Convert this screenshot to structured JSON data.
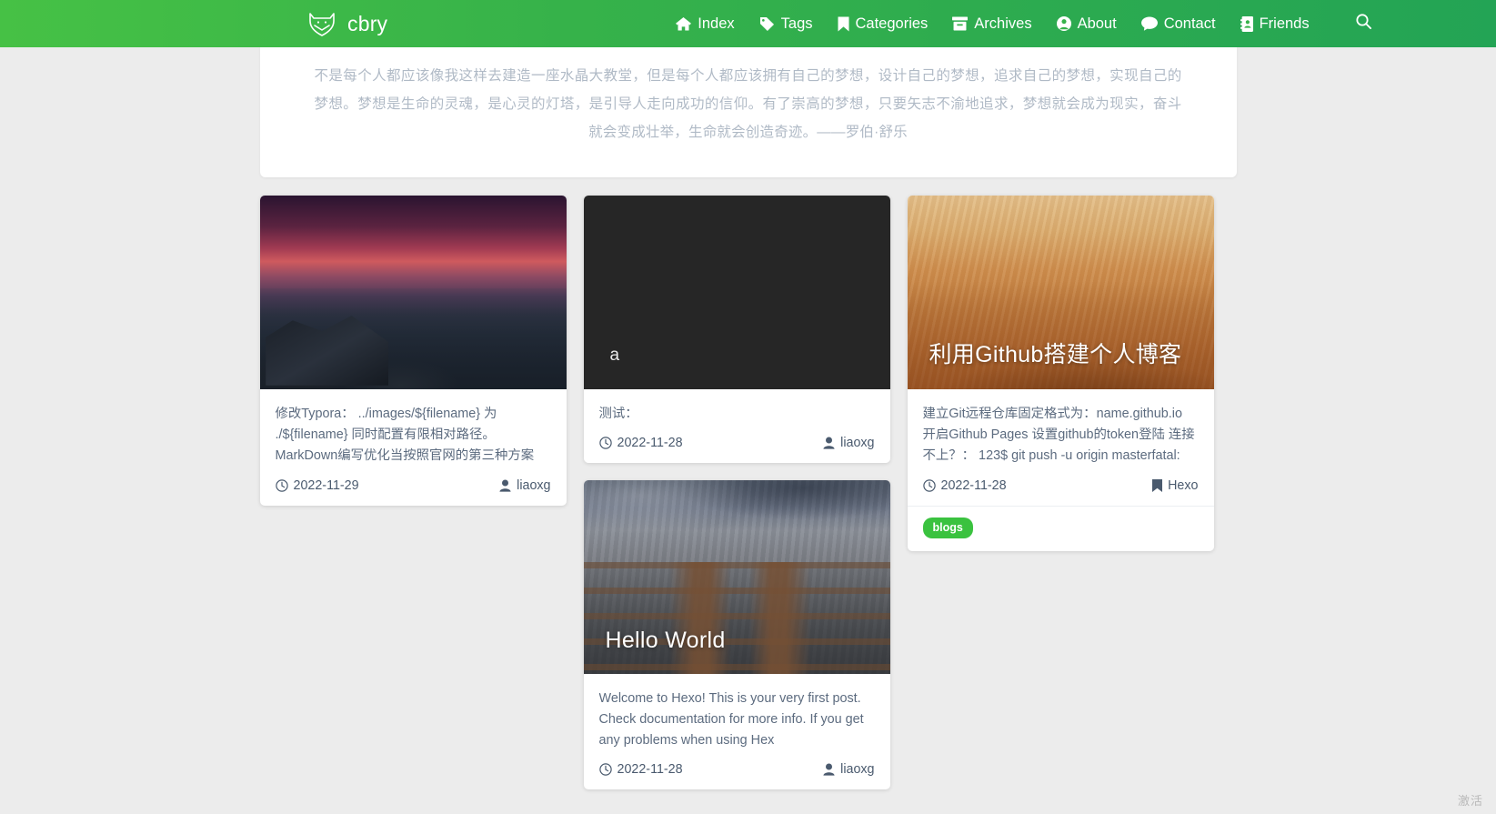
{
  "navbar": {
    "brand": {
      "name": "cbry",
      "logo_icon": "fox-logo-icon"
    },
    "accent_color": "#36b24a",
    "links": [
      {
        "label": "Index",
        "icon": "home-icon"
      },
      {
        "label": "Tags",
        "icon": "tag-icon"
      },
      {
        "label": "Categories",
        "icon": "bookmark-icon"
      },
      {
        "label": "Archives",
        "icon": "archive-box-icon"
      },
      {
        "label": "About",
        "icon": "user-circle-icon"
      },
      {
        "label": "Contact",
        "icon": "comment-icon"
      },
      {
        "label": "Friends",
        "icon": "address-book-icon"
      }
    ],
    "search": {
      "icon": "search-icon",
      "label": ""
    }
  },
  "quote": {
    "text": "不是每个人都应该像我这样去建造一座水晶大教堂，但是每个人都应该拥有自己的梦想，设计自己的梦想，追求自己的梦想，实现自己的梦想。梦想是生命的灵魂，是心灵的灯塔，是引导人走向成功的信仰。有了崇高的梦想，只要矢志不渝地追求，梦想就会成为现实，奋斗就会变成壮举，生命就会创造奇迹。——罗伯·舒乐"
  },
  "columns": [
    {
      "cards": [
        {
          "id": "card-typora",
          "image": "cliff-sunset-photo",
          "title": "",
          "title_visible": false,
          "excerpt": "修改Typora： ../images/${filename} 为 ./${filename} 同时配置有限相对路径。 MarkDown编写优化当按照官网的第三种方案来，会有markdown …",
          "date": "2022-11-29",
          "date_icon": "clock-icon",
          "author": "liaoxg",
          "author_icon": "user-icon",
          "tags": []
        }
      ]
    },
    {
      "cards": [
        {
          "id": "card-a",
          "image": "dark-placeholder",
          "title": "a",
          "title_visible": true,
          "excerpt": "测试：",
          "date": "2022-11-28",
          "date_icon": "clock-icon",
          "author": "liaoxg",
          "author_icon": "user-icon",
          "tags": []
        },
        {
          "id": "card-hello-world",
          "image": "railway-tracks-photo",
          "title": "Hello World",
          "title_visible": true,
          "excerpt": "Welcome to Hexo! This is your very first post. Check documentation for more info. If you get any problems when using Hex",
          "date": "2022-11-28",
          "date_icon": "clock-icon",
          "author": "liaoxg",
          "author_icon": "user-icon",
          "tags": []
        }
      ]
    },
    {
      "cards": [
        {
          "id": "card-github-blog",
          "image": "desert-dunes-photo",
          "title": "利用Github搭建个人博客",
          "title_visible": true,
          "excerpt": "建立Git远程仓库固定格式为：name.github.io 开启Github Pages 设置github的token登陆 连接不上？： 123$ git push -u origin masterfatal: unab …",
          "date": "2022-11-28",
          "date_icon": "clock-icon",
          "author": "Hexo",
          "author_icon": "bookmark-solid-icon",
          "tags": [
            {
              "label": "blogs",
              "color": "#3ac23f"
            }
          ]
        }
      ]
    }
  ],
  "watermark": {
    "text": "激活"
  }
}
